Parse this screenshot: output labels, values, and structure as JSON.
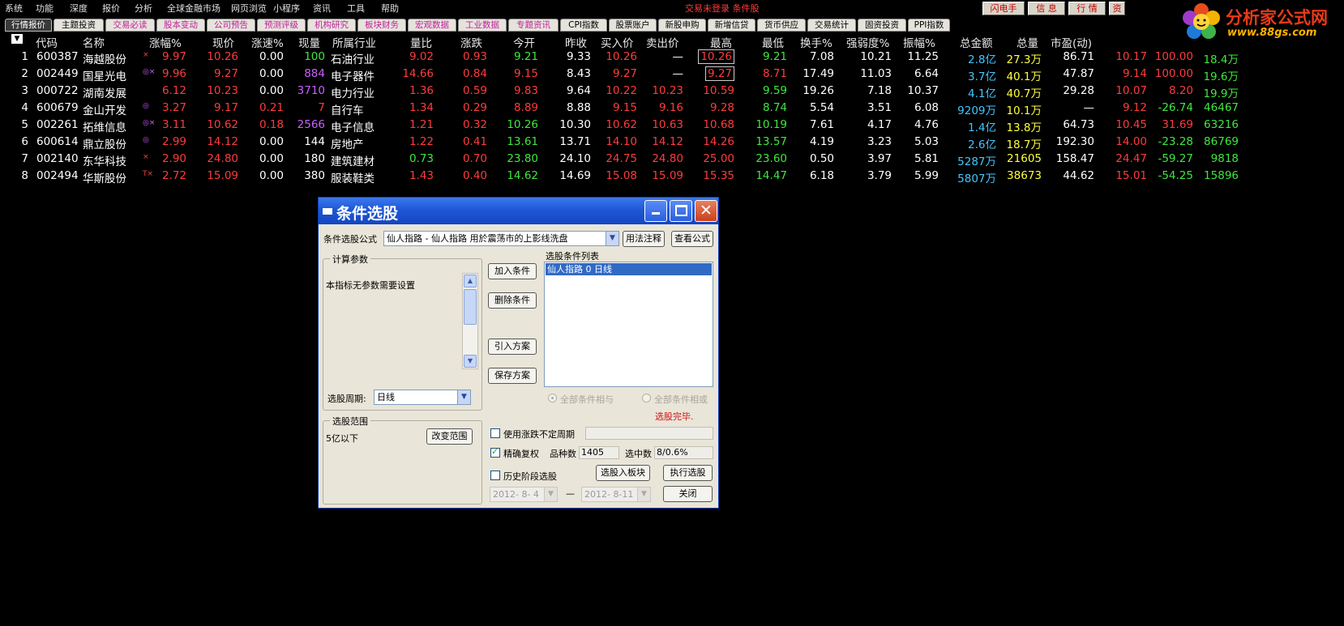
{
  "menu": {
    "items": [
      "系统",
      "功能",
      "深度",
      "报价",
      "分析",
      "全球金融市场",
      "网页浏览",
      "小程序",
      "资讯",
      "工具",
      "帮助"
    ],
    "status": "交易未登录  条件股"
  },
  "top_buttons": [
    "闪电手",
    "信 息",
    "行 情",
    "资"
  ],
  "logo": {
    "brand": "分析家公式网",
    "url": "www.88gs.com"
  },
  "tabs": [
    {
      "label": "行情报价",
      "style": "active"
    },
    {
      "label": "主题投资",
      "style": "normal"
    },
    {
      "label": "交易必读",
      "style": "pink"
    },
    {
      "label": "股本变动",
      "style": "pink"
    },
    {
      "label": "公司预告",
      "style": "pink"
    },
    {
      "label": "预测评级",
      "style": "pink"
    },
    {
      "label": "机构研究",
      "style": "pink"
    },
    {
      "label": "板块财务",
      "style": "pink"
    },
    {
      "label": "宏观数据",
      "style": "pink"
    },
    {
      "label": "工业数据",
      "style": "pink"
    },
    {
      "label": "专题资讯",
      "style": "pink"
    },
    {
      "label": "CPI指数",
      "style": "normal"
    },
    {
      "label": "股票账户",
      "style": "normal"
    },
    {
      "label": "新股申购",
      "style": "normal"
    },
    {
      "label": "新增信贷",
      "style": "normal"
    },
    {
      "label": "货币供应",
      "style": "normal"
    },
    {
      "label": "交易统计",
      "style": "normal"
    },
    {
      "label": "固资投资",
      "style": "normal"
    },
    {
      "label": "PPI指数",
      "style": "normal"
    }
  ],
  "table": {
    "sort_marker": "▼",
    "headers": [
      "代码",
      "名称",
      "涨幅%",
      "现价",
      "涨速%",
      "现量",
      "所属行业",
      "量比",
      "涨跌",
      "今开",
      "昨收",
      "买入价",
      "卖出价",
      "最高",
      "最低",
      "换手%",
      "强弱度%",
      "振幅%",
      "总金额",
      "总量",
      "市盈(动)"
    ],
    "rows": [
      [
        "1",
        "600387",
        "海越股份",
        "×",
        "9.97",
        "10.26",
        "0.00",
        "100",
        "石油行业",
        "9.02",
        "0.93",
        "9.21",
        "9.33",
        "10.26",
        "—",
        "10.26",
        "9.21",
        "7.08",
        "10.21",
        "11.25",
        "2.8亿",
        "27.3万",
        "86.71",
        "10.17",
        "100.00",
        "18.4万"
      ],
      [
        "2",
        "002449",
        "国星光电",
        "◎×",
        "9.96",
        "9.27",
        "0.00",
        "884",
        "电子器件",
        "14.66",
        "0.84",
        "9.15",
        "8.43",
        "9.27",
        "—",
        "9.27",
        "8.71",
        "17.49",
        "11.03",
        "6.64",
        "3.7亿",
        "40.1万",
        "47.87",
        "9.14",
        "100.00",
        "19.6万"
      ],
      [
        "3",
        "000722",
        "湖南发展",
        "",
        "6.12",
        "10.23",
        "0.00",
        "3710",
        "电力行业",
        "1.36",
        "0.59",
        "9.83",
        "9.64",
        "10.22",
        "10.23",
        "10.59",
        "9.59",
        "19.26",
        "7.18",
        "10.37",
        "4.1亿",
        "40.7万",
        "29.28",
        "10.07",
        "8.20",
        "19.9万"
      ],
      [
        "4",
        "600679",
        "金山开发",
        "◎",
        "3.27",
        "9.17",
        "0.21",
        "7",
        "自行车",
        "1.34",
        "0.29",
        "8.89",
        "8.88",
        "9.15",
        "9.16",
        "9.28",
        "8.74",
        "5.54",
        "3.51",
        "6.08",
        "9209万",
        "10.1万",
        "—",
        "9.12",
        "-26.74",
        "46467"
      ],
      [
        "5",
        "002261",
        "拓维信息",
        "◎×",
        "3.11",
        "10.62",
        "0.18",
        "2566",
        "电子信息",
        "1.21",
        "0.32",
        "10.26",
        "10.30",
        "10.62",
        "10.63",
        "10.68",
        "10.19",
        "7.61",
        "4.17",
        "4.76",
        "1.4亿",
        "13.8万",
        "64.73",
        "10.45",
        "31.69",
        "63216"
      ],
      [
        "6",
        "600614",
        "鼎立股份",
        "◎",
        "2.99",
        "14.12",
        "0.00",
        "144",
        "房地产",
        "1.22",
        "0.41",
        "13.61",
        "13.71",
        "14.10",
        "14.12",
        "14.26",
        "13.57",
        "4.19",
        "3.23",
        "5.03",
        "2.6亿",
        "18.7万",
        "192.30",
        "14.00",
        "-23.28",
        "86769"
      ],
      [
        "7",
        "002140",
        "东华科技",
        "×",
        "2.90",
        "24.80",
        "0.00",
        "180",
        "建筑建材",
        "0.73",
        "0.70",
        "23.80",
        "24.10",
        "24.75",
        "24.80",
        "25.00",
        "23.60",
        "0.50",
        "3.97",
        "5.81",
        "5287万",
        "21605",
        "158.47",
        "24.47",
        "-59.27",
        "9818"
      ],
      [
        "8",
        "002494",
        "华斯股份",
        "T×",
        "2.72",
        "15.09",
        "0.00",
        "380",
        "服装鞋类",
        "1.43",
        "0.40",
        "14.62",
        "14.69",
        "15.08",
        "15.09",
        "15.35",
        "14.47",
        "6.18",
        "3.79",
        "5.99",
        "5807万",
        "38673",
        "44.62",
        "15.01",
        "-54.25",
        "15896"
      ]
    ]
  },
  "dialog": {
    "title": "条件选股",
    "formula_label": "条件选股公式",
    "formula_value": "仙人指路 - 仙人指路 用於震荡市的上影线洗盘",
    "btn_usage": "用法注释",
    "btn_view": "查看公式",
    "params_group": "计算参数",
    "params_text": "本指标无参数需要设置",
    "period_label": "选股周期:",
    "period_value": "日线",
    "range_group": "选股范围",
    "range_text": "5亿以下",
    "btn_change_range": "改变范围",
    "btn_add": "加入条件",
    "btn_delete": "删除条件",
    "btn_import": "引入方案",
    "btn_save": "保存方案",
    "list_label": "选股条件列表",
    "list_items": [
      "仙人指路  0  日线"
    ],
    "radio_and": "全部条件相与",
    "radio_or": "全部条件相或",
    "done_text": "选股完毕.",
    "chk_uncertain": "使用涨跌不定周期",
    "chk_exact": "精确复权",
    "variety_label": "品种数",
    "variety_value": "1405",
    "selected_label": "选中数",
    "selected_value": "8/0.6%",
    "chk_history": "历史阶段选股",
    "btn_to_block": "选股入板块",
    "btn_execute": "执行选股",
    "date_from": "2012- 8- 4",
    "date_to": "2012- 8-11",
    "dash": "—",
    "btn_close": "关闭"
  },
  "colors": {
    "red": "#ff3b3b",
    "green": "#3ee83e",
    "white": "#ffffff",
    "yellow": "#ffff3c",
    "cyan": "#45c6ff",
    "magenta": "#c860ff",
    "title_blue": "#1f57d6"
  }
}
